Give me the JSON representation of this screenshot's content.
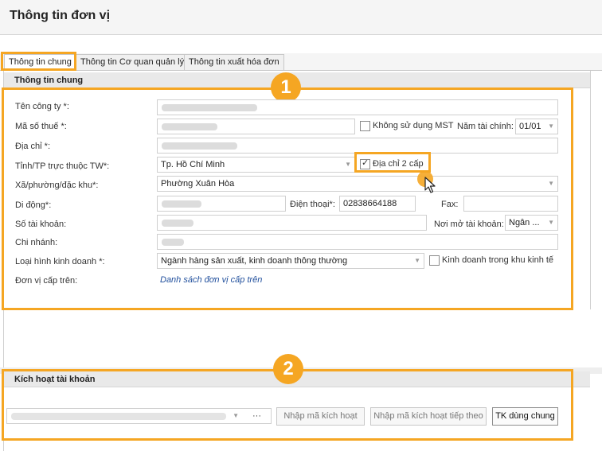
{
  "window": {
    "title": "Thông tin đơn vị"
  },
  "tabs": [
    {
      "label": "Thông tin chung"
    },
    {
      "label": "Thông tin Cơ quan quản lý"
    },
    {
      "label": "Thông tin xuất hóa đơn"
    }
  ],
  "general": {
    "header": "Thông tin chung",
    "badge": "1",
    "labels": {
      "company": "Tên công ty *:",
      "tax_code": "Mã số thuế *:",
      "address": "Địa chỉ *:",
      "province": "Tỉnh/TP trực thuộc TW*:",
      "ward": "Xã/phường/đặc khu*:",
      "mobile": "Di động*:",
      "phone": "Điện thoại*:",
      "fax": "Fax:",
      "account_no": "Số tài khoản:",
      "bank_place": "Nơi mở tài khoản:",
      "branch": "Chi nhánh:",
      "business_type": "Loại hình kinh doanh *:",
      "parent_unit": "Đơn vị cấp trên:"
    },
    "values": {
      "province": "Tp. Hồ Chí Minh",
      "ward": "Phường Xuân Hòa",
      "phone": "02838664188",
      "fax": "",
      "bank_place": "Ngân ...",
      "business_type": "Ngành hàng sản xuất, kinh doanh thông thường",
      "fiscal_year": "01/01"
    },
    "checkboxes": {
      "no_tax_code": {
        "label": "Không sử dụng MST",
        "checked": false
      },
      "two_level_address": {
        "label": "Địa chỉ 2 cấp",
        "checked": true
      },
      "economic_zone": {
        "label": "Kinh doanh trong khu kinh tế",
        "checked": false
      }
    },
    "fiscal_year_label": "Năm tài chính:",
    "parent_unit_link": "Danh sách đơn vị cấp trên"
  },
  "activation": {
    "header": "Kích hoạt tài khoản",
    "badge": "2",
    "buttons": {
      "more": "···",
      "enter_code": "Nhập mã kích hoạt",
      "enter_next_code": "Nhập mã kích hoạt tiếp theo",
      "shared_account": "TK dùng chung"
    }
  },
  "colors": {
    "highlight": "#f5a623",
    "link": "#1f4e9c",
    "header_bg": "#e9e9e9"
  }
}
